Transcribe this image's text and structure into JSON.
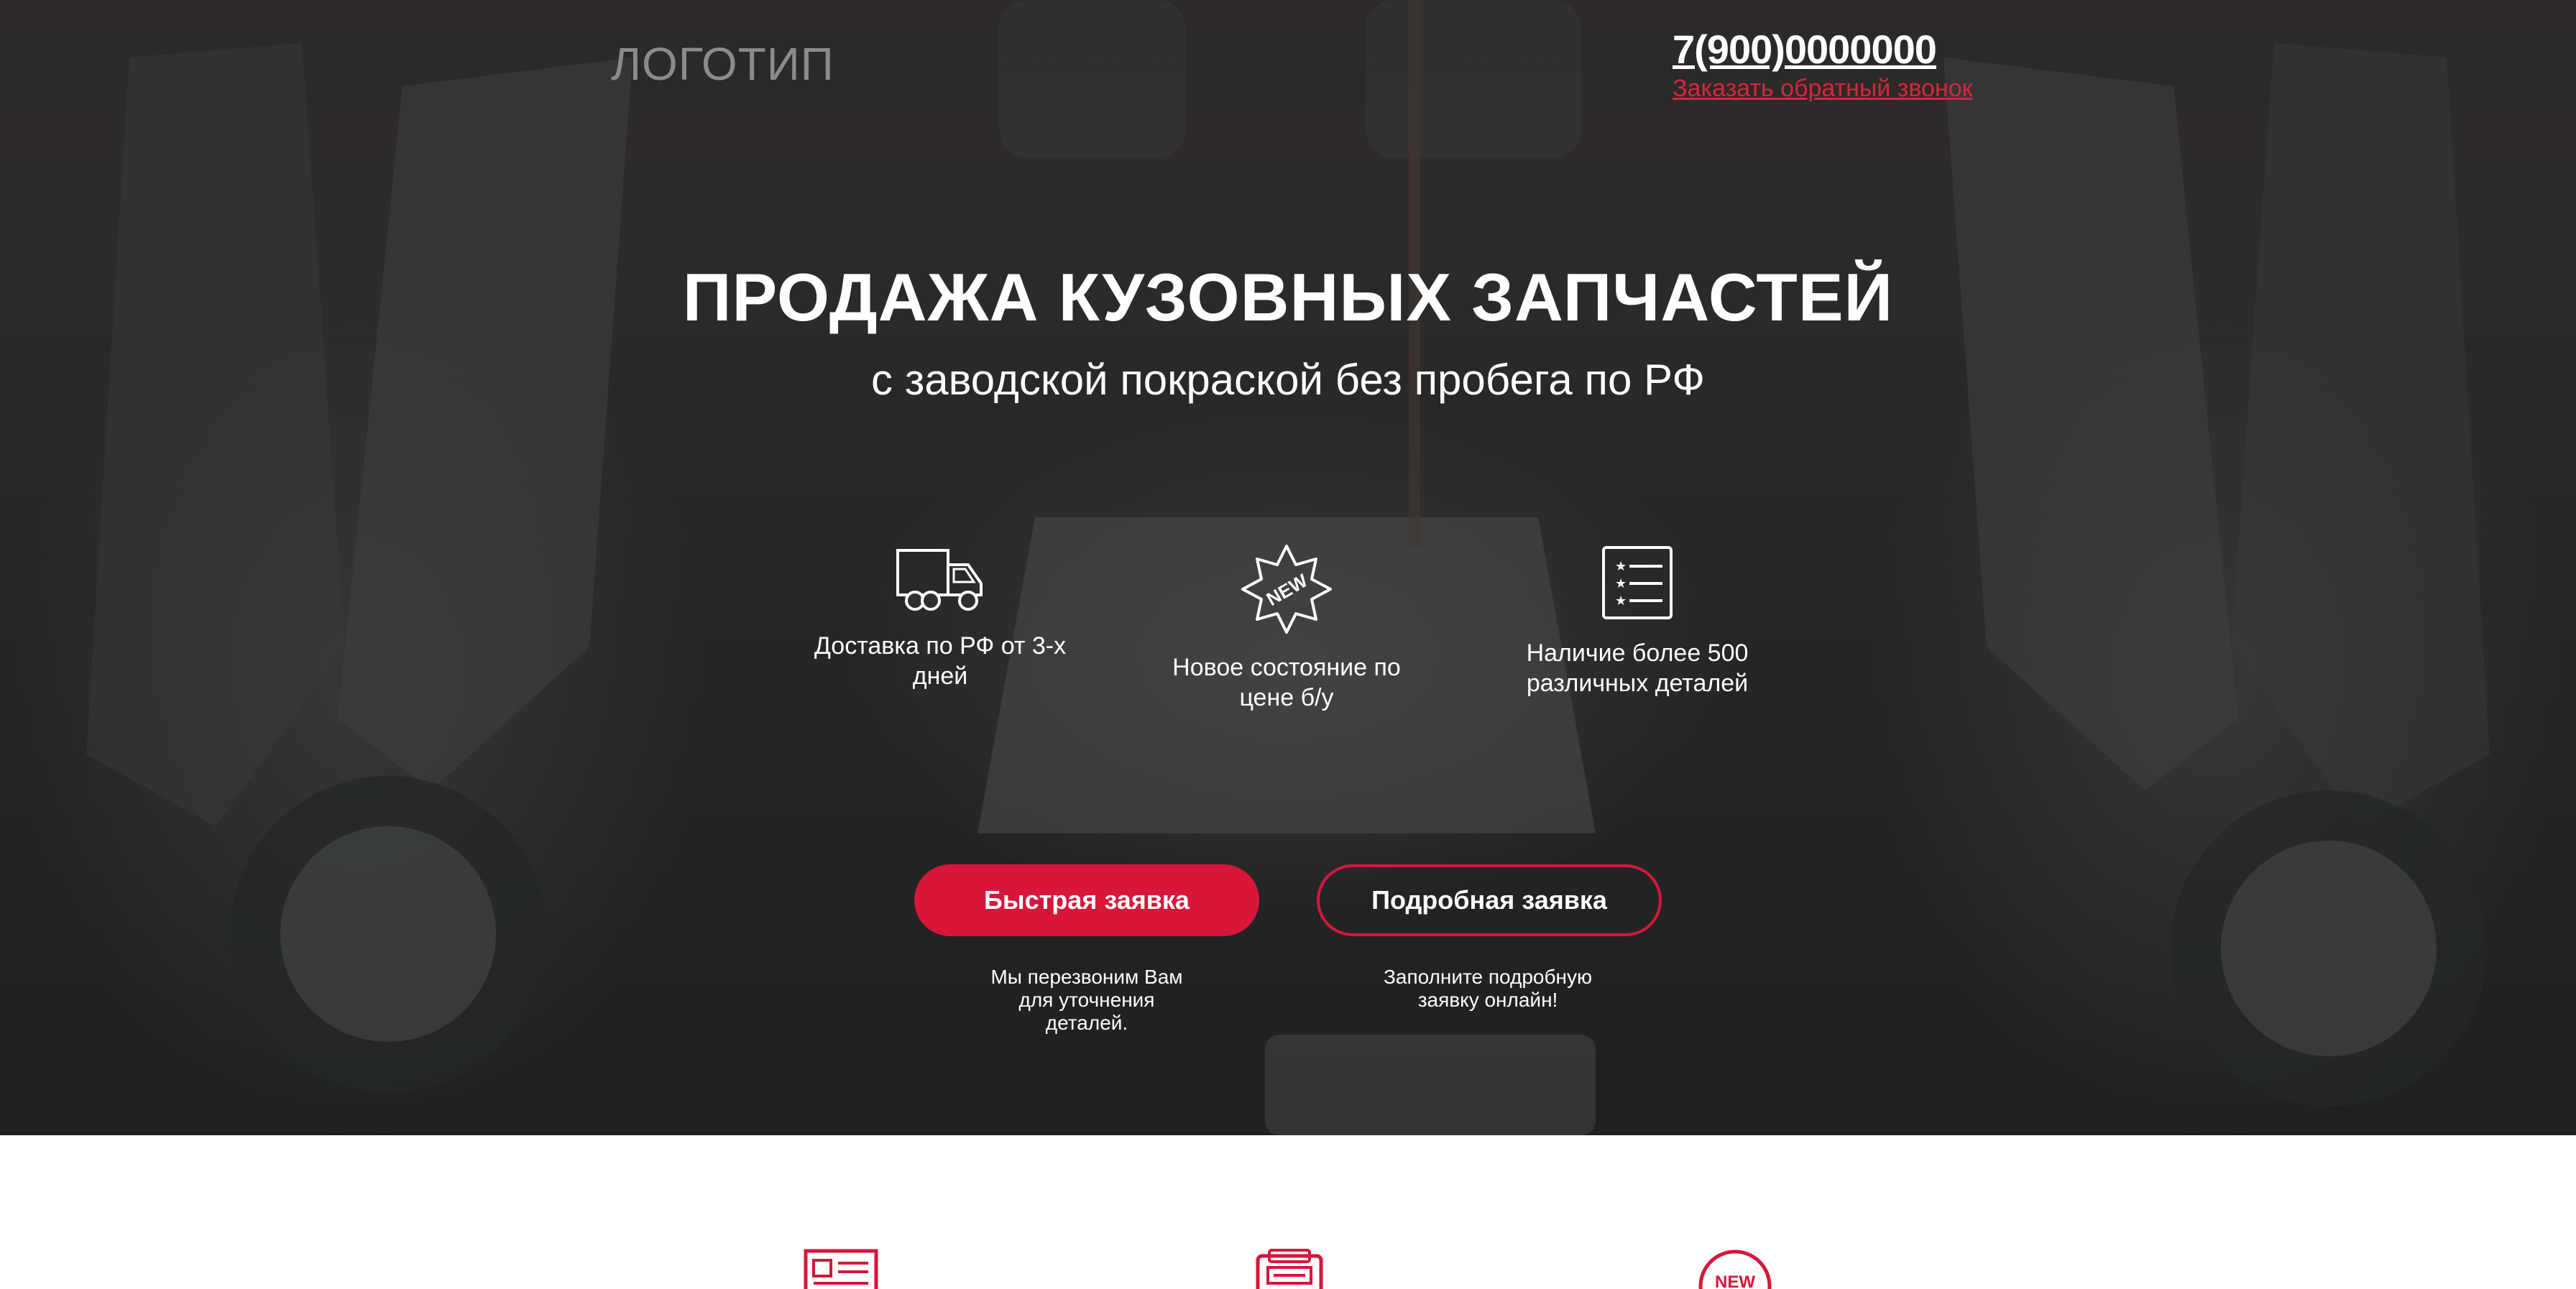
{
  "header": {
    "logo": "ЛОГОТИП",
    "phone": "7(900)0000000",
    "callback_link": "Заказать обратный звонок"
  },
  "hero": {
    "title": "ПРОДАЖА КУЗОВНЫХ ЗАПЧАСТЕЙ",
    "subtitle": "с заводской покраской без пробега по РФ",
    "features": [
      {
        "icon": "truck-icon",
        "label": "Доставка по РФ от 3-х дней"
      },
      {
        "icon": "new-badge-icon",
        "label": "Новое состояние по цене б/у"
      },
      {
        "icon": "checklist-icon",
        "label": "Наличие более 500 различных деталей"
      }
    ]
  },
  "actions": {
    "quick_label": "Быстрая заявка",
    "quick_note": "Мы перезвоним Вам для уточнения деталей.",
    "detailed_label": "Подробная заявка",
    "detailed_note": "Заполните подробную заявку онлайн!"
  },
  "section2": {
    "icons": [
      "form-icon",
      "register-icon",
      "new-badge-icon"
    ],
    "new_badge_text": "NEW"
  },
  "colors": {
    "accent": "#d7163a",
    "link": "#d7263d",
    "text_light": "#ffffff",
    "logo_gray": "#8b8b8b"
  }
}
